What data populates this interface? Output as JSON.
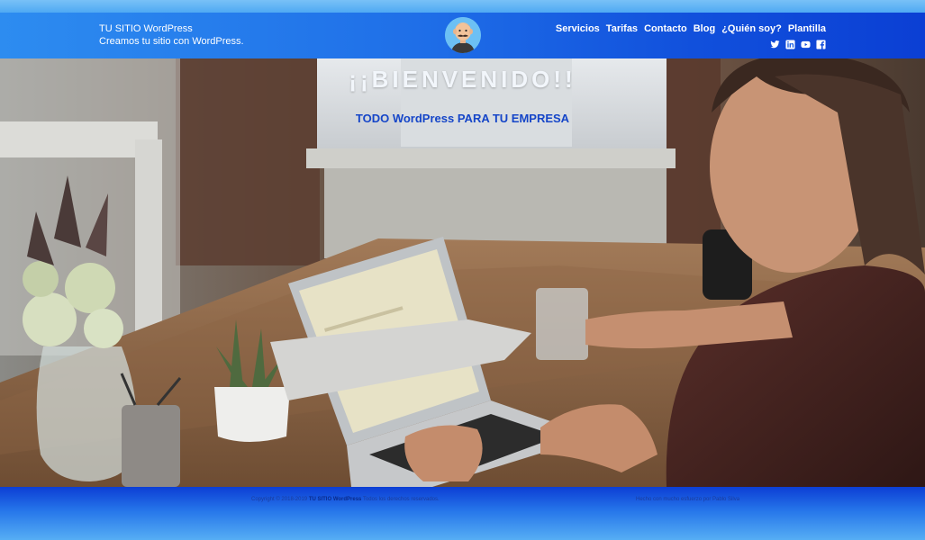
{
  "header": {
    "site_title": "TU SITIO WordPress",
    "tagline": "Creamos tu sitio con WordPress.",
    "nav": [
      "Servicios",
      "Tarifas",
      "Contacto",
      "Blog",
      "¿Quién soy?",
      "Plantilla"
    ],
    "social": [
      "twitter-icon",
      "linkedin-icon",
      "youtube-icon",
      "facebook-icon"
    ],
    "avatar": "cartoon-man-with-mustache"
  },
  "hero": {
    "title": "¡¡BIENVENIDO!!",
    "subtitle": "TODO WordPress PARA TU EMPRESA",
    "image": "man-working-on-laptop-at-wooden-table"
  },
  "footer": {
    "copyright_prefix": "Copyright © 2018-2019",
    "copyright_brand": "TU SITIO WordPress",
    "copyright_suffix": "Todos los derechos reservados.",
    "credit": "Hecho con mucho esfuerzo por Pablo Silva"
  },
  "colors": {
    "header_start": "#2d8cf0",
    "header_end": "#0b3fd4",
    "subtitle": "#1545c8",
    "footer_text": "#1b3c9c"
  }
}
